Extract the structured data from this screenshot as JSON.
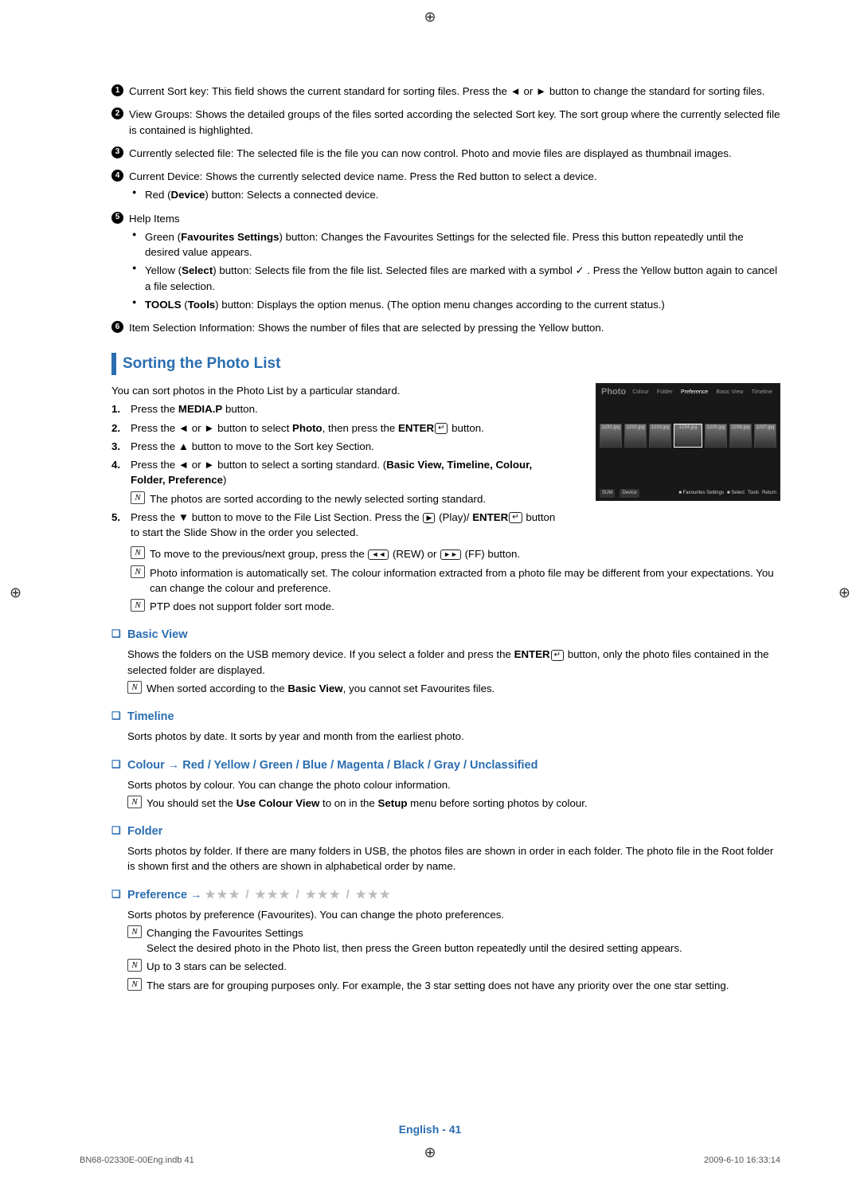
{
  "numbered": [
    {
      "lead": "Current Sort key:",
      "text": " This field shows the current standard for sorting files. Press the ◄ or ► button to change the standard for sorting files."
    },
    {
      "lead": "View Groups:",
      "text": " Shows the detailed groups of the files sorted according the selected Sort key. The sort group where the currently selected file is contained is highlighted."
    },
    {
      "lead": "Currently selected file:",
      "text": " The selected file is the file you can now control. Photo and movie files are displayed as thumbnail images."
    },
    {
      "lead": "Current Device:",
      "text": " Shows the currently selected device name. Press the Red button to select a device.",
      "bullets": [
        {
          "pre": "Red (",
          "boldmid": "Device",
          "post": ") button: Selects a connected device."
        }
      ]
    },
    {
      "lead": "Help Items",
      "text": "",
      "bullets": [
        {
          "pre": "Green (",
          "boldmid": "Favourites Settings",
          "post": ") button: Changes the Favourites Settings for the selected file. Press this button repeatedly until the desired value appears."
        },
        {
          "pre": "Yellow (",
          "boldmid": "Select",
          "post": ") button: Selects file from the file list. Selected files are marked with a symbol ✓ . Press the Yellow button again to cancel a file selection."
        },
        {
          "pre": "",
          "boldmid": "TOOLS",
          "post": " (",
          "bold2": "Tools",
          "post2": ") button: Displays the option menus. (The option menu changes according to the current status.)"
        }
      ]
    },
    {
      "lead": "Item Selection Information:",
      "text": " Shows the number of files that are selected by pressing the Yellow button."
    }
  ],
  "numbers": [
    "1",
    "2",
    "3",
    "4",
    "5",
    "6"
  ],
  "sectionTitle": "Sorting the Photo List",
  "intro": "You can sort photos in the Photo List by a particular standard.",
  "steps": {
    "s1a": "Press the ",
    "s1b": "MEDIA.P",
    "s1c": " button.",
    "s2a": "Press the ◄ or ► button to select ",
    "s2b": "Photo",
    "s2c": ", then press the ",
    "s2d": "ENTER",
    "s2e": " button.",
    "s3": "Press the ▲ button to move to the Sort key Section.",
    "s4a": "Press the ◄ or ► button to select a sorting standard. (",
    "s4b": "Basic View, Timeline, Colour, Folder, Preference",
    "s4c": ")",
    "s4n": "The photos are sorted according to the newly selected sorting standard.",
    "s5a": "Press the ▼ button to move to the File List Section. Press the ",
    "s5play": "▶",
    "s5b": " (Play)/ ",
    "s5c": "ENTER",
    "s5d": " button to start the Slide Show in the order you selected.",
    "s5n1a": "To move to the previous/next group, press the ",
    "s5rew": "◄◄",
    "s5n1b": " (REW) or ",
    "s5ff": "►►",
    "s5n1c": " (FF) button.",
    "s5n2": "Photo information is automatically set. The colour information extracted from a photo file may be different from your expectations. You can change the colour and preference.",
    "s5n3": "PTP does not support folder sort mode."
  },
  "subs": {
    "bv": {
      "h": "Basic View",
      "p1a": "Shows the folders on the USB memory device. If you select a folder and press the ",
      "p1b": "ENTER",
      "p1c": " button, only the photo files contained in the selected folder are displayed.",
      "n1a": "When sorted according to the ",
      "n1b": "Basic View",
      "n1c": ", you cannot set Favourites files."
    },
    "tl": {
      "h": "Timeline",
      "p": "Sorts photos by date. It sorts by year and month from the earliest photo."
    },
    "col": {
      "h": "Colour → Red / Yellow / Green / Blue / Magenta / Black / Gray / Unclassified",
      "p": "Sorts photos by colour. You can change the photo colour information.",
      "na": "You should set the ",
      "nb": "Use Colour View",
      "nc": " to on in the ",
      "nd": "Setup",
      "ne": " menu before sorting photos by colour."
    },
    "fd": {
      "h": "Folder",
      "p": "Sorts photos by folder. If there are many folders in USB, the photos files are shown in order in each folder. The photo file in the Root folder is shown first and the others are shown in alphabetical order by name."
    },
    "pr": {
      "h": "Preference → ",
      "stars": "★★★ / ★★★ / ★★★ / ★★★",
      "p": "Sorts photos by preference (Favourites). You can change the photo preferences.",
      "n1": "Changing the Favourites Settings",
      "n1b": "Select the desired photo in the Photo list, then press the Green button repeatedly until the desired setting appears.",
      "n2": "Up to 3 stars can be selected.",
      "n3": "The stars are for grouping purposes only. For example, the 3 star setting does not have any priority over the one star setting."
    }
  },
  "thumb": {
    "title": "Photo",
    "tabs": [
      "Colour",
      "Folder",
      "Preference",
      "Basic View",
      "Timeline"
    ],
    "selTab": "Preference",
    "names": [
      "1231.jpg",
      "1232.jpg",
      "1233.jpg",
      "1234.jpg",
      "1235.jpg",
      "1236.jpg",
      "1237.jpg"
    ],
    "bottom": {
      "sum": "SUM",
      "device": "Device",
      "fav": "Favourites Settings",
      "select": "Select",
      "tools": "Tools",
      "ret": "Return"
    }
  },
  "footerPage": "English - 41",
  "footerLeft": "BN68-02330E-00Eng.indb   41",
  "footerRight": "2009-6-10   16:33:14"
}
